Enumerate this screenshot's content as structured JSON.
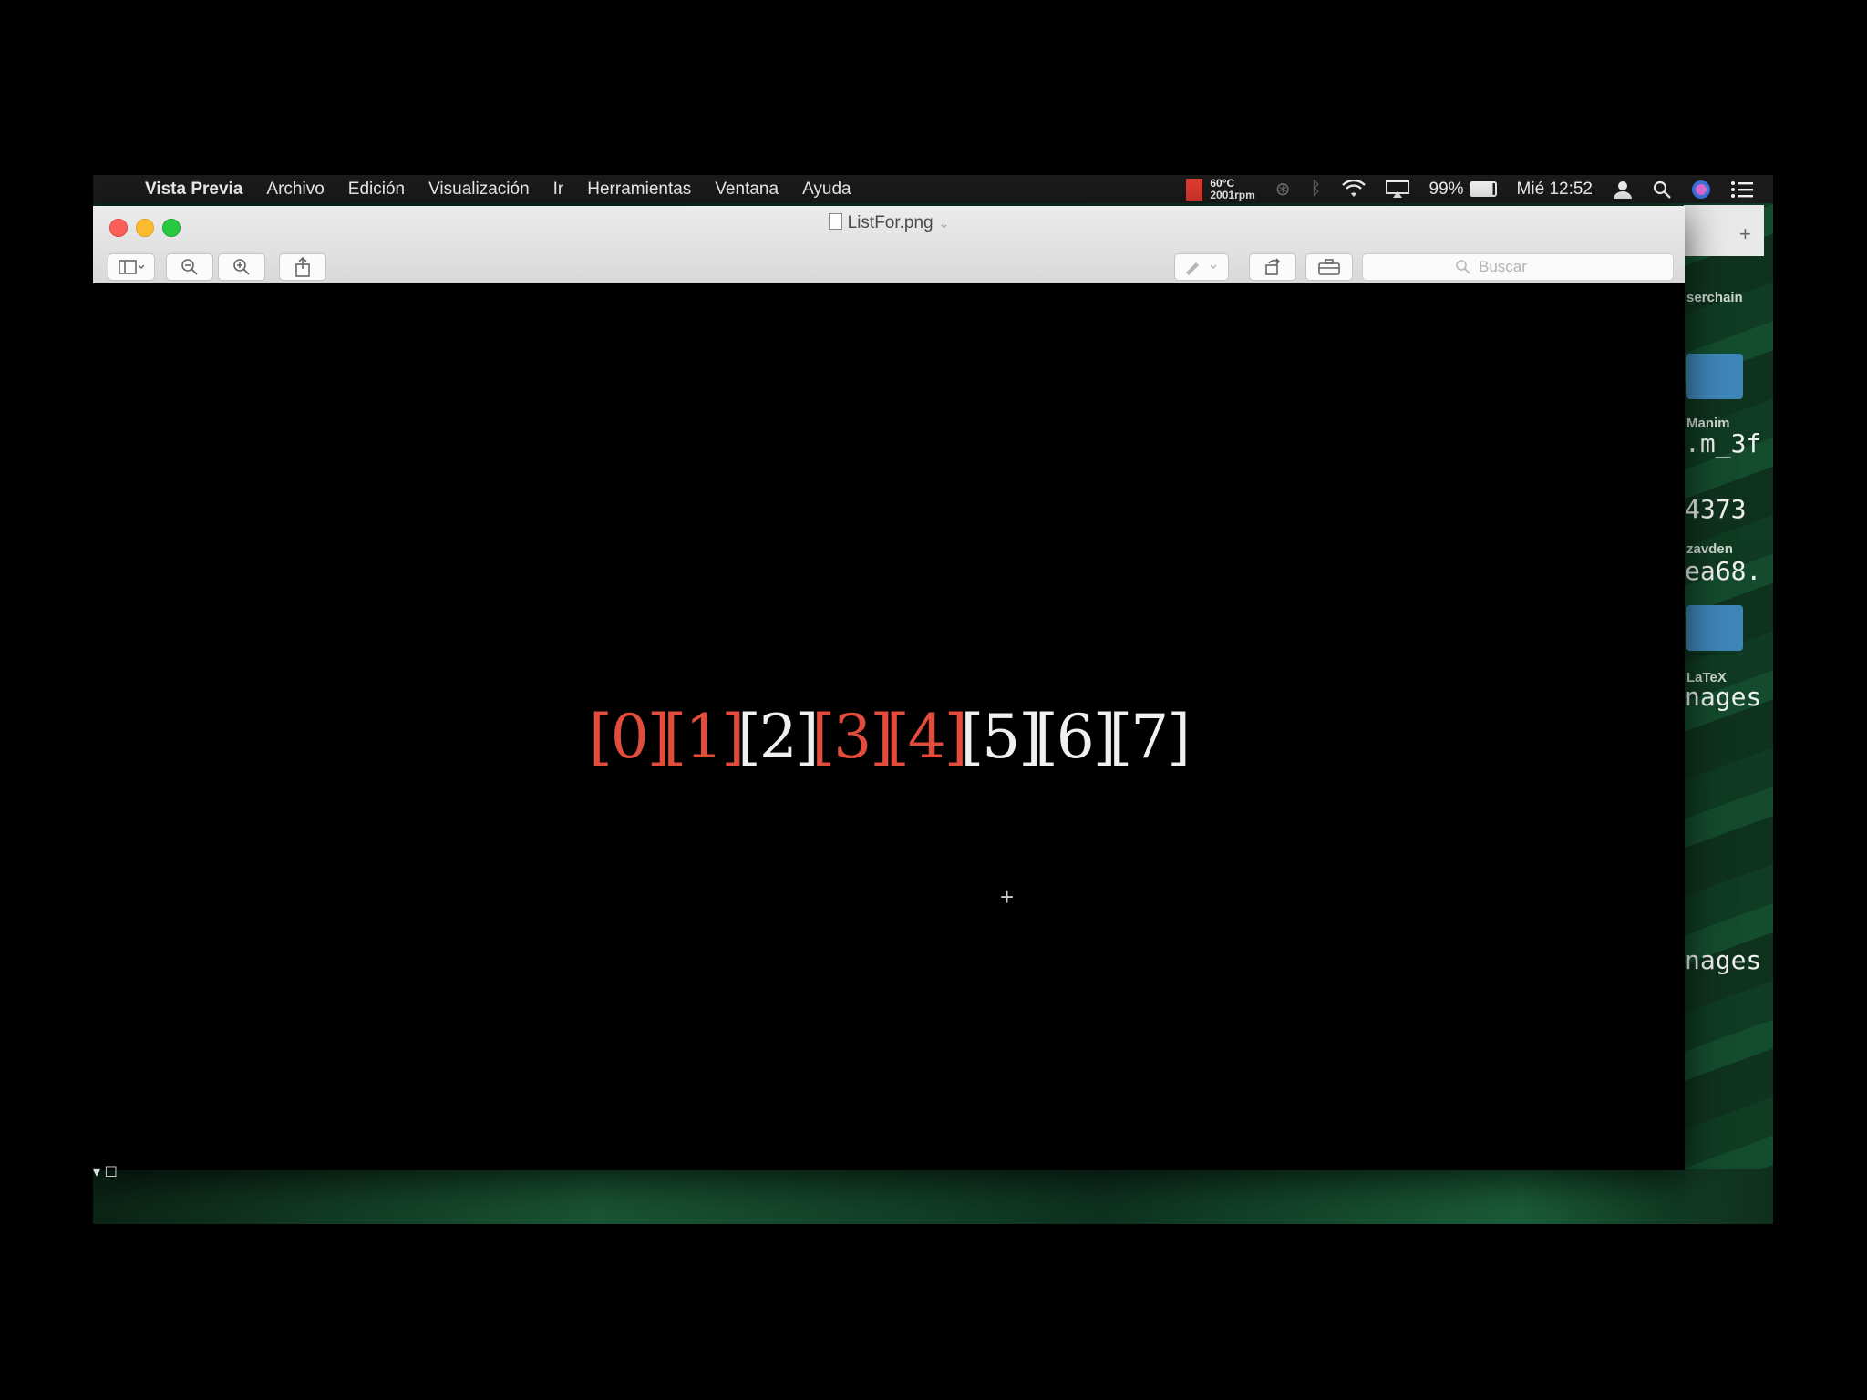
{
  "menubar": {
    "apple": "",
    "app_name": "Vista Previa",
    "items": [
      "Archivo",
      "Edición",
      "Visualización",
      "Ir",
      "Herramientas",
      "Ventana",
      "Ayuda"
    ],
    "status": {
      "temp": "60°C",
      "rpm": "2001rpm",
      "battery": "99%",
      "clock": "Mié 12:52"
    }
  },
  "window": {
    "title": "ListFor.png",
    "search_placeholder": "Buscar"
  },
  "document": {
    "elements": [
      {
        "text": "[0]",
        "color": "#e24c3c"
      },
      {
        "text": "[1]",
        "color": "#e24c3c"
      },
      {
        "text": "[2]",
        "color": "#f0f0f0"
      },
      {
        "text": "[3]",
        "color": "#e24c3c"
      },
      {
        "text": "[4]",
        "color": "#e24c3c"
      },
      {
        "text": "[5]",
        "color": "#f0f0f0"
      },
      {
        "text": "[6]",
        "color": "#f0f0f0"
      },
      {
        "text": "[7]",
        "color": "#f0f0f0"
      }
    ]
  },
  "finder_partial": {
    "labels": [
      "serchain",
      "Manim",
      "zavden",
      "LaTeX"
    ],
    "names": [
      ".m_3f",
      "4373",
      "ea68.",
      "nages",
      "nages"
    ]
  }
}
